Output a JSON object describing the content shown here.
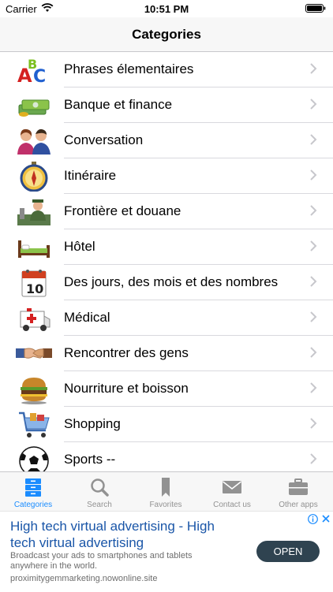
{
  "status_bar": {
    "carrier": "Carrier",
    "time": "10:51 PM"
  },
  "nav": {
    "title": "Categories"
  },
  "categories": [
    {
      "label": "Phrases élementaires",
      "icon": "abc-letters-icon"
    },
    {
      "label": "Banque et finance",
      "icon": "money-stack-icon"
    },
    {
      "label": "Conversation",
      "icon": "two-people-icon"
    },
    {
      "label": "Itinéraire",
      "icon": "compass-icon"
    },
    {
      "label": "Frontière et douane",
      "icon": "customs-officer-icon"
    },
    {
      "label": "Hôtel",
      "icon": "bed-icon"
    },
    {
      "label": "Des jours, des mois et des nombres",
      "icon": "calendar-icon"
    },
    {
      "label": "Médical",
      "icon": "ambulance-icon"
    },
    {
      "label": "Rencontrer des gens",
      "icon": "handshake-icon"
    },
    {
      "label": "Nourriture et boisson",
      "icon": "burger-icon"
    },
    {
      "label": "Shopping",
      "icon": "shopping-cart-icon"
    },
    {
      "label": "Sports --",
      "icon": "soccer-ball-icon"
    }
  ],
  "tabs": [
    {
      "label": "Categories",
      "icon": "categories-icon",
      "active": true
    },
    {
      "label": "Search",
      "icon": "search-icon",
      "active": false
    },
    {
      "label": "Favorites",
      "icon": "bookmark-icon",
      "active": false
    },
    {
      "label": "Contact us",
      "icon": "mail-icon",
      "active": false
    },
    {
      "label": "Other apps",
      "icon": "briefcase-icon",
      "active": false
    }
  ],
  "ad": {
    "headline": "High tech virtual advertising - High tech virtual advertising",
    "body": "Broadcast your ads to smartphones and tablets anywhere in the world.",
    "url": "proximitygemmarketing.nowonline.site",
    "button": "OPEN"
  },
  "colors": {
    "accent": "#1a8cff",
    "tab_inactive": "#929292",
    "ad_button": "#2f4350"
  }
}
